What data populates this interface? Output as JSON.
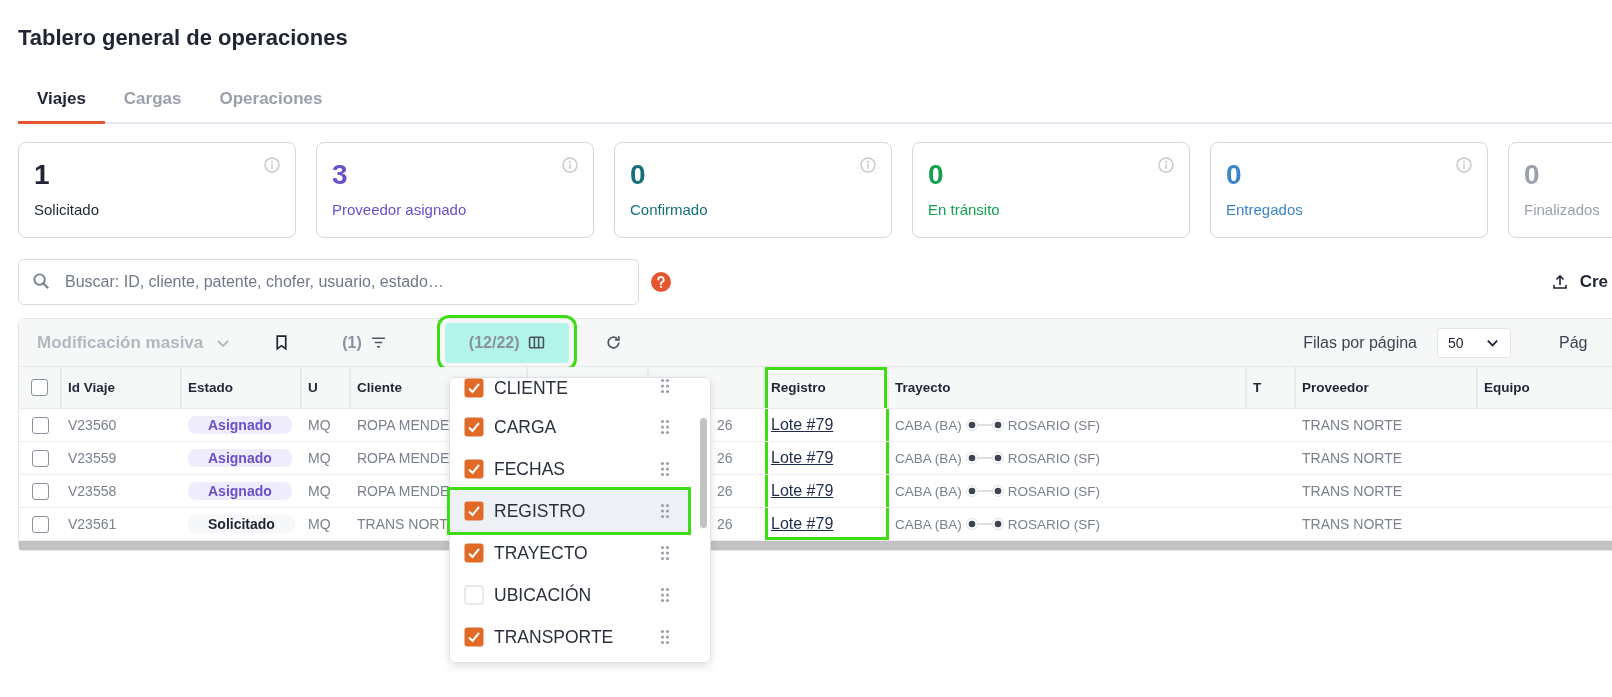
{
  "title": "Tablero general de operaciones",
  "tabs": [
    {
      "label": "Viajes",
      "selected": true
    },
    {
      "label": "Cargas",
      "selected": false
    },
    {
      "label": "Operaciones",
      "selected": false
    }
  ],
  "stats": [
    {
      "value": "1",
      "label": "Solicitado",
      "color": "#1f2533"
    },
    {
      "value": "3",
      "label": "Proveedor asignado",
      "color": "#6a4fc9"
    },
    {
      "value": "0",
      "label": "Confirmado",
      "color": "#12707a"
    },
    {
      "value": "0",
      "label": "En tránsito",
      "color": "#13a150"
    },
    {
      "value": "0",
      "label": "Entregados",
      "color": "#3a86c8"
    },
    {
      "value": "0",
      "label": "Finalizados",
      "color": "#9aa1ab"
    }
  ],
  "search": {
    "placeholder": "Buscar: ID, cliente, patente, chofer, usuario, estado…"
  },
  "create_button": {
    "label": "Cre"
  },
  "toolbar": {
    "bulk_edit": "Modificación masiva",
    "filter_count": "(1)",
    "columns_count": "(12/22)",
    "columns_highlighted": true,
    "rows_per_page_label": "Filas por página",
    "rows_per_page": "50",
    "page_label": "Pág"
  },
  "column_menu": {
    "items": [
      {
        "label": "CLIENTE",
        "checked": true,
        "highlighted": false
      },
      {
        "label": "CARGA",
        "checked": true,
        "highlighted": false
      },
      {
        "label": "FECHAS",
        "checked": true,
        "highlighted": false
      },
      {
        "label": "REGISTRO",
        "checked": true,
        "highlighted": true
      },
      {
        "label": "TRAYECTO",
        "checked": true,
        "highlighted": false
      },
      {
        "label": "UBICACIÓN",
        "checked": false,
        "highlighted": false
      },
      {
        "label": "TRANSPORTE",
        "checked": true,
        "highlighted": false
      }
    ]
  },
  "table": {
    "all_checked": false,
    "columns": [
      {
        "label": "Id Viaje",
        "highlighted": false
      },
      {
        "label": "Estado",
        "highlighted": false
      },
      {
        "label": "U",
        "highlighted": false
      },
      {
        "label": "Cliente",
        "highlighted": false
      },
      {
        "highlighted": false
      },
      {
        "highlighted": false
      },
      {
        "label": "Registro",
        "highlighted": true
      },
      {
        "label": "Trayecto",
        "highlighted": false
      },
      {
        "label": "T",
        "highlighted": false
      },
      {
        "label": "Proveedor",
        "highlighted": false
      },
      {
        "label": "Equipo",
        "highlighted": false
      }
    ],
    "rows": [
      {
        "checked": false,
        "id": "V23560",
        "status": {
          "label": "Asignado",
          "kind": "assigned"
        },
        "u": "MQ",
        "client": "ROPA MENDE",
        "column_6": "26",
        "registro": "Lote #79",
        "route": {
          "from": "CABA (BA)",
          "to": "ROSARIO (SF)"
        },
        "provider": "TRANS NORTE"
      },
      {
        "checked": false,
        "id": "V23559",
        "status": {
          "label": "Asignado",
          "kind": "assigned"
        },
        "u": "MQ",
        "client": "ROPA MENDE",
        "column_6": "26",
        "registro": "Lote #79",
        "route": {
          "from": "CABA (BA)",
          "to": "ROSARIO (SF)"
        },
        "provider": "TRANS NORTE"
      },
      {
        "checked": false,
        "id": "V23558",
        "status": {
          "label": "Asignado",
          "kind": "assigned"
        },
        "u": "MQ",
        "client": "ROPA MENDE",
        "column_6": "26",
        "registro": "Lote #79",
        "route": {
          "from": "CABA (BA)",
          "to": "ROSARIO (SF)"
        },
        "provider": "TRANS NORTE"
      },
      {
        "checked": false,
        "id": "V23561",
        "status": {
          "label": "Solicitado",
          "kind": "requested"
        },
        "u": "MQ",
        "client": "TRANS NORT",
        "column_6": "26",
        "registro": "Lote #79",
        "route": {
          "from": "CABA (BA)",
          "to": "ROSARIO (SF)"
        },
        "provider": "TRANS NORTE"
      }
    ]
  }
}
